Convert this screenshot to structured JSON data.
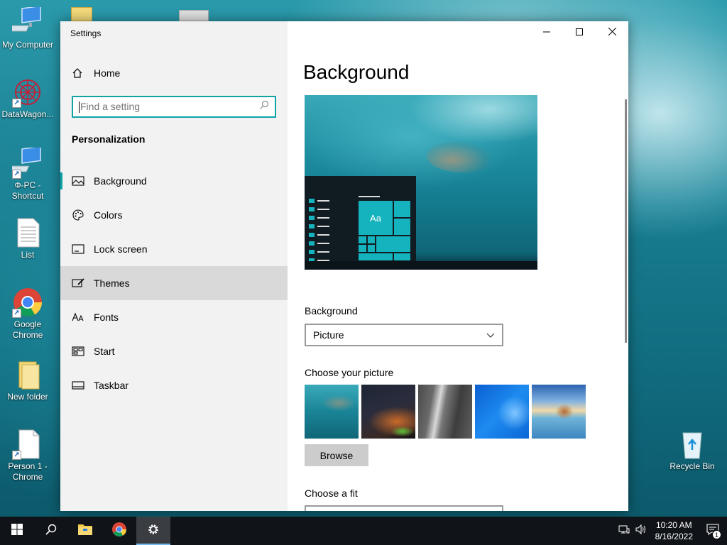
{
  "desktop": {
    "icons": [
      {
        "label": "My Computer",
        "icon": "computer-icon"
      },
      {
        "label": "DataWagon...",
        "icon": "network-app-icon"
      },
      {
        "label": "Ф-PC -\nShortcut",
        "icon": "computer-shortcut-icon"
      },
      {
        "label": "List",
        "icon": "text-file-icon"
      },
      {
        "label": "Google\nChrome",
        "icon": "chrome-icon"
      },
      {
        "label": "New folder",
        "icon": "folder-icon"
      },
      {
        "label": "Person 1 -\nChrome",
        "icon": "file-shortcut-icon"
      },
      {
        "label": "Recycle Bin",
        "icon": "recycle-bin-icon"
      }
    ]
  },
  "window": {
    "title": "Settings",
    "controls": {
      "minimize": "minimize-icon",
      "maximize": "maximize-icon",
      "close": "close-icon"
    }
  },
  "nav": {
    "home_label": "Home",
    "search_placeholder": "Find a setting",
    "section_title": "Personalization",
    "items": [
      {
        "label": "Background",
        "icon": "picture-icon",
        "active": true
      },
      {
        "label": "Colors",
        "icon": "palette-icon"
      },
      {
        "label": "Lock screen",
        "icon": "lock-screen-icon"
      },
      {
        "label": "Themes",
        "icon": "themes-icon",
        "hover": true
      },
      {
        "label": "Fonts",
        "icon": "fonts-icon"
      },
      {
        "label": "Start",
        "icon": "start-icon"
      },
      {
        "label": "Taskbar",
        "icon": "taskbar-icon"
      }
    ]
  },
  "main": {
    "page_title": "Background",
    "preview": {
      "tile_label": "Aa"
    },
    "background_label": "Background",
    "background_value": "Picture",
    "choose_picture_label": "Choose your picture",
    "pictures": [
      "underwater-swimmer",
      "night-sky-tent",
      "rock-waterfall",
      "windows-blue",
      "beach-rocks"
    ],
    "browse_label": "Browse",
    "choose_fit_label": "Choose a fit"
  },
  "taskbar": {
    "apps": [
      "start-icon",
      "search-icon",
      "file-explorer-icon",
      "chrome-icon",
      "settings-icon"
    ],
    "active_app": "settings-icon",
    "clock_time": "10:20 AM",
    "clock_date": "8/16/2022",
    "notification_count": "1"
  },
  "colors": {
    "accent": "#0fa3a6",
    "taskbar": "#101318",
    "nav_bg": "#f2f2f2",
    "hover_bg": "#d9d9d9"
  }
}
